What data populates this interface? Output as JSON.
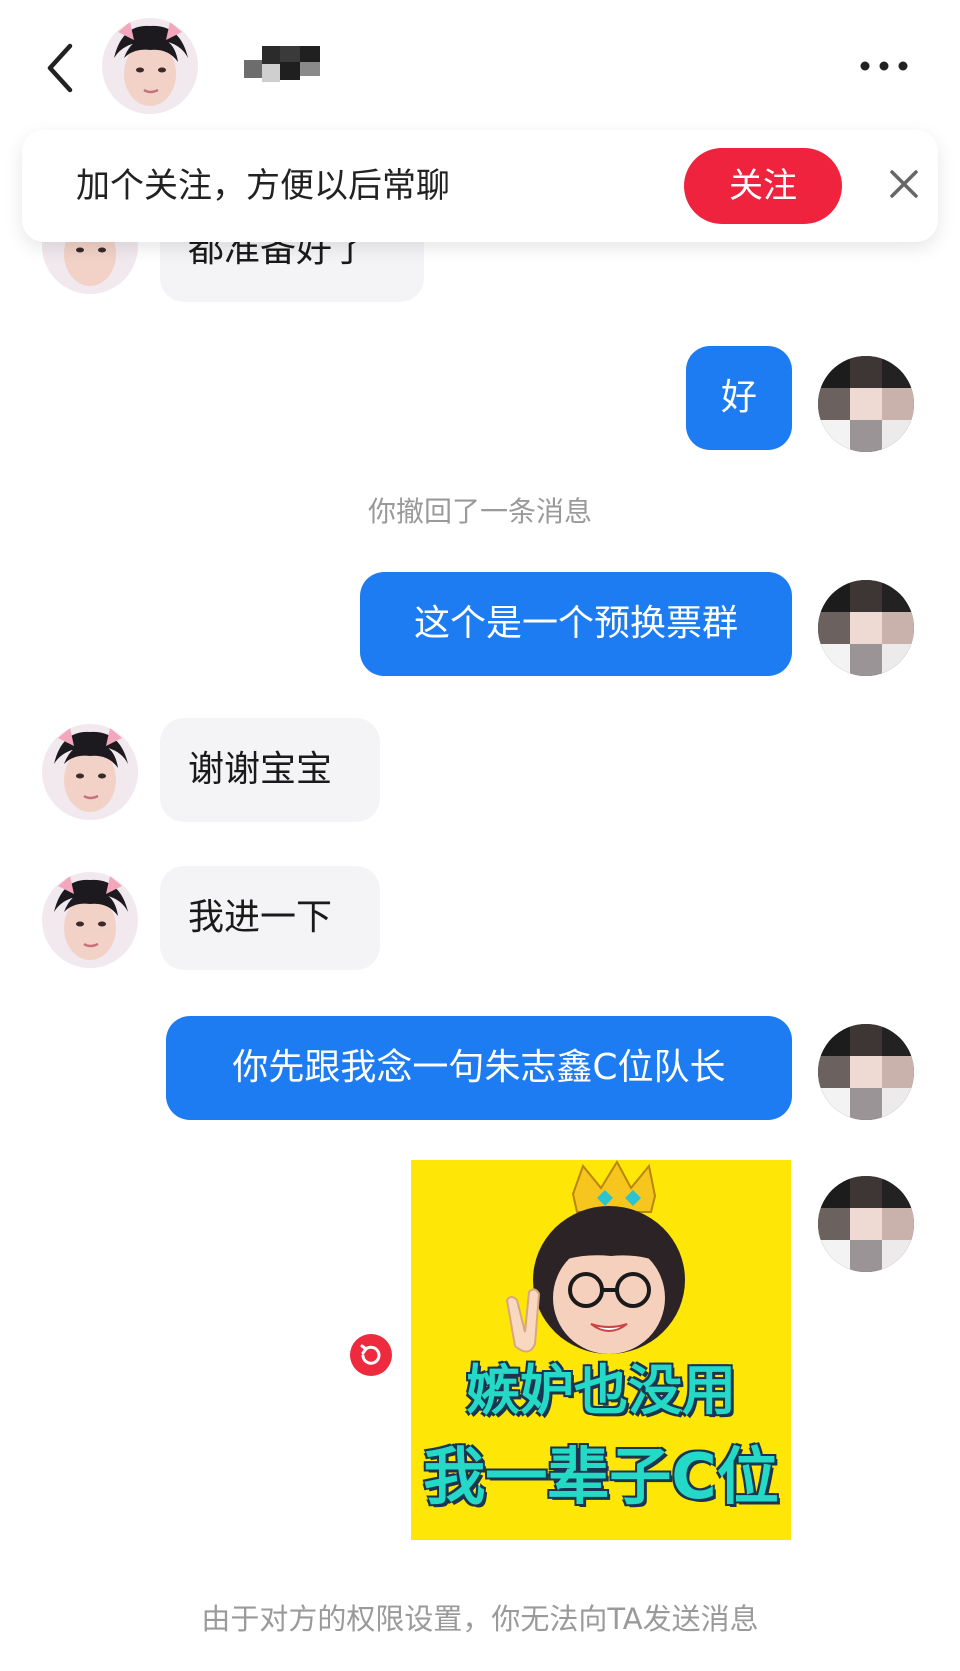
{
  "banner": {
    "text": "加个关注，方便以后常聊",
    "follow_label": "关注"
  },
  "messages": {
    "partial_left": "都准备好了",
    "msg1": "好",
    "recall_notice": "你撤回了一条消息",
    "msg2": "这个是一个预换票群",
    "msg3": "谢谢宝宝",
    "msg4": "我进一下",
    "msg5": "你先跟我念一句朱志鑫C位队长"
  },
  "sticker": {
    "line1": "嫉妒也没用",
    "line2": "我一辈子C位"
  },
  "footer": {
    "notice": "由于对方的权限设置，你无法向TA发送消息"
  },
  "colors": {
    "accent_blue": "#1e7cf2",
    "follow_red": "#f0233f",
    "sticker_yellow": "#fee606",
    "sticker_text": "#25d9c7"
  },
  "icons": [
    "back-icon",
    "more-icon",
    "close-icon",
    "resend-icon"
  ]
}
